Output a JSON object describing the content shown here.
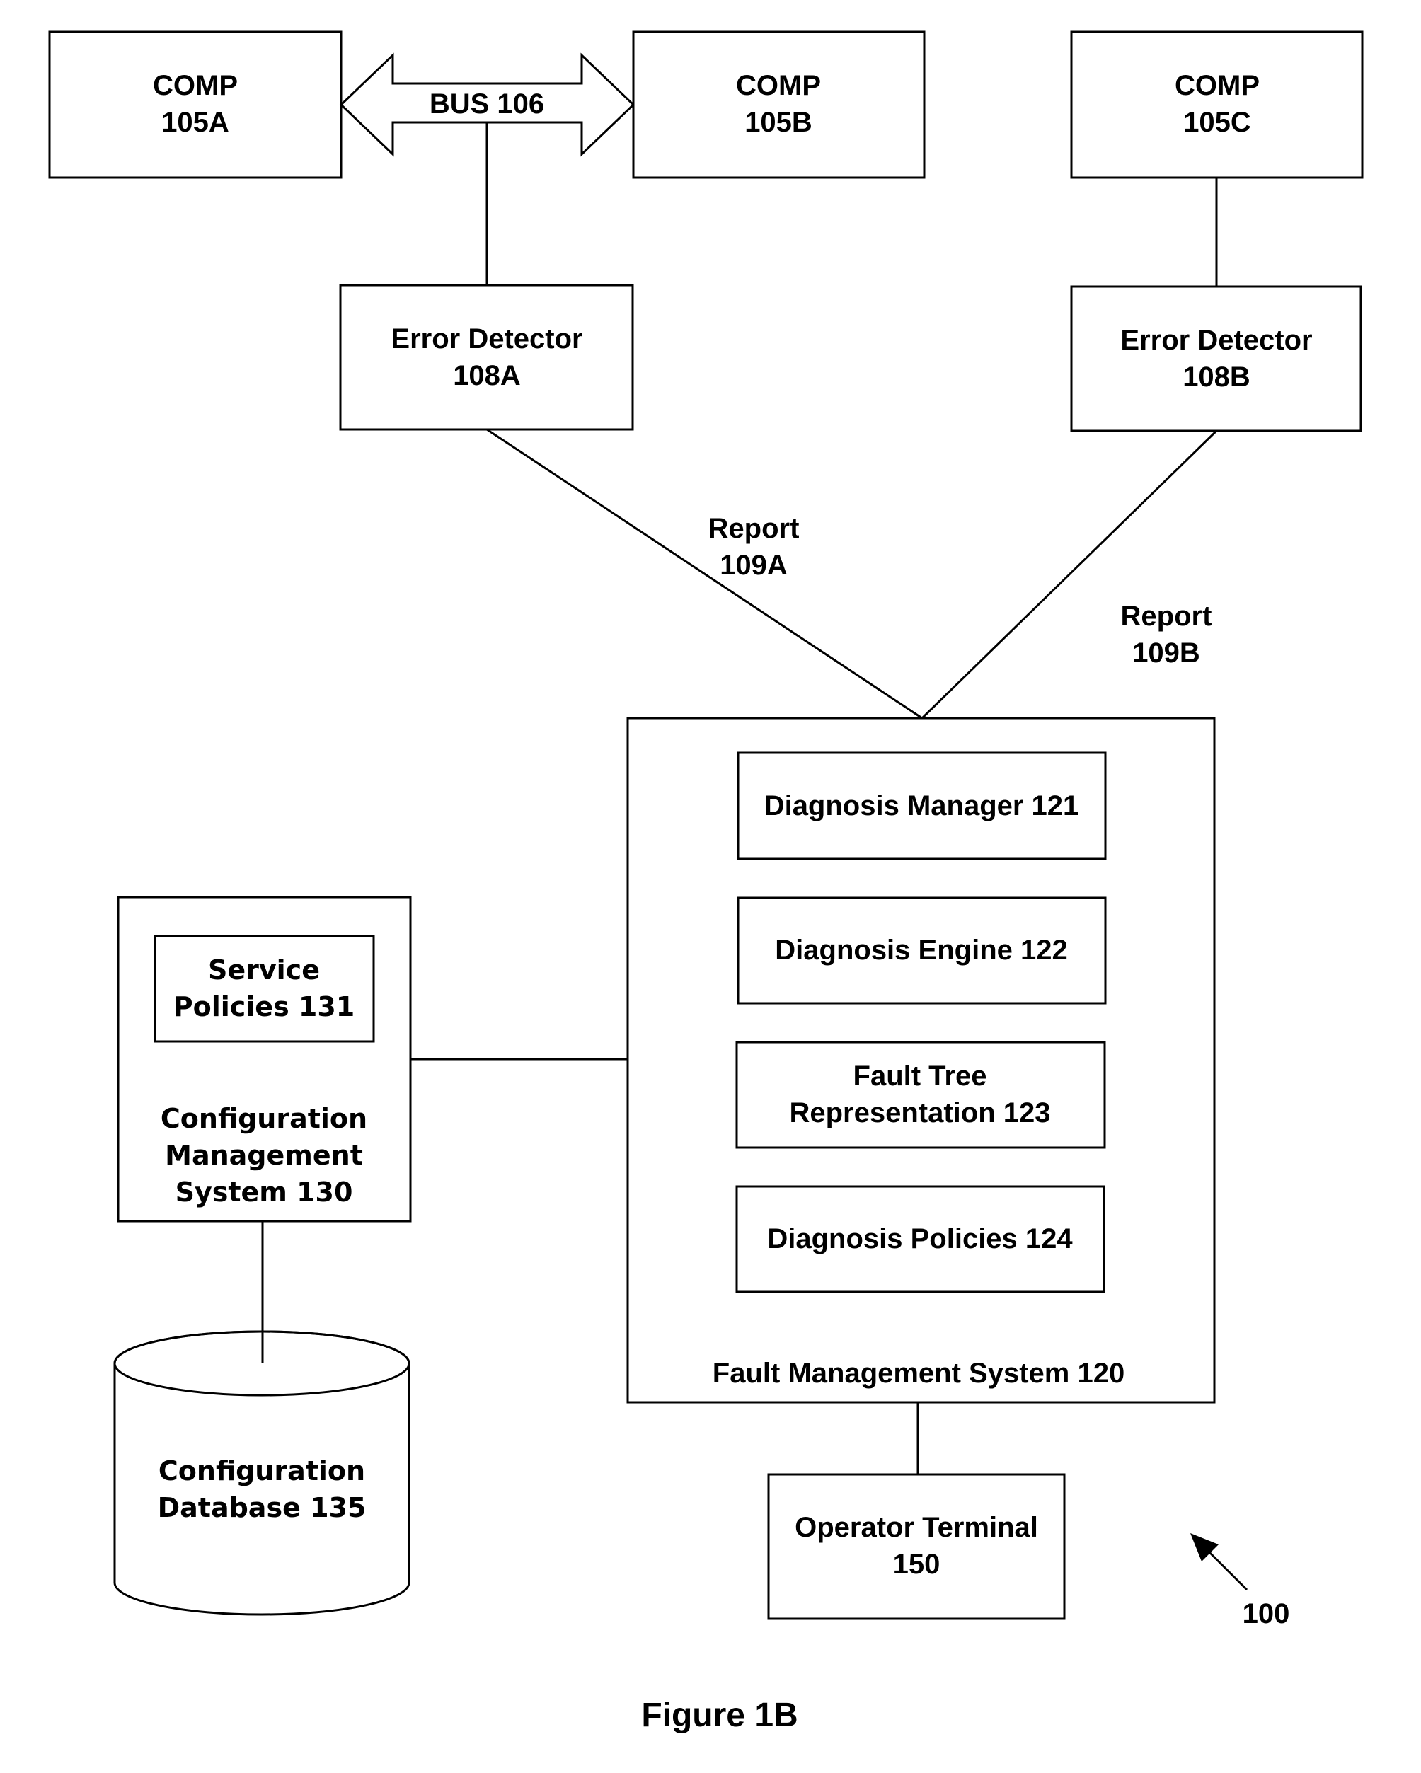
{
  "figure": {
    "caption": "Figure 1B",
    "reference_numeral": "100"
  },
  "components": {
    "comp_a": {
      "line1": "COMP",
      "line2": "105A"
    },
    "comp_b": {
      "line1": "COMP",
      "line2": "105B"
    },
    "comp_c": {
      "line1": "COMP",
      "line2": "105C"
    }
  },
  "bus": {
    "label": "BUS 106"
  },
  "error_detectors": {
    "a": {
      "line1": "Error Detector",
      "line2": "108A"
    },
    "b": {
      "line1": "Error Detector",
      "line2": "108B"
    }
  },
  "reports": {
    "a": {
      "line1": "Report",
      "line2": "109A"
    },
    "b": {
      "line1": "Report",
      "line2": "109B"
    }
  },
  "fault_management_system": {
    "label": "Fault Management System 120",
    "modules": [
      {
        "lines": [
          "Diagnosis Manager 121"
        ]
      },
      {
        "lines": [
          "Diagnosis Engine 122"
        ]
      },
      {
        "lines": [
          "Fault Tree",
          "Representation 123"
        ]
      },
      {
        "lines": [
          "Diagnosis Policies 124"
        ]
      }
    ]
  },
  "configuration_management_system": {
    "lines": [
      "Configuration",
      "Management",
      "System 130"
    ],
    "service_policies": {
      "lines": [
        "Service",
        "Policies 131"
      ]
    }
  },
  "configuration_database": {
    "lines": [
      "Configuration",
      "Database 135"
    ]
  },
  "operator_terminal": {
    "lines": [
      "Operator Terminal",
      "150"
    ]
  }
}
